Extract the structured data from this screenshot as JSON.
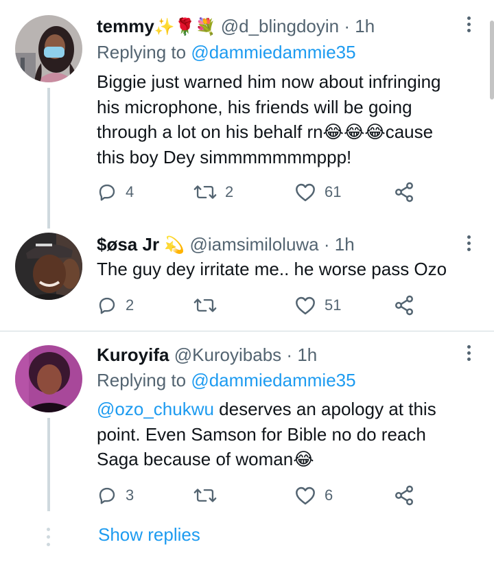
{
  "colors": {
    "accent": "#1d9bf0",
    "secondary": "#536471",
    "text": "#0f1419",
    "line": "#cfd9de"
  },
  "tweets": [
    {
      "name": "temmy",
      "name_emoji": "✨🌹💐",
      "handle": "@d_blingdoyin",
      "dot": "·",
      "time": "1h",
      "replying_prefix": "Replying to",
      "replying_to": "@dammiedammie35",
      "text_lines": [
        "Biggie just warned him now about infringing",
        "his microphone, his friends will be going",
        "through a lot on his behalf rn😂😂😂cause",
        "this boy Dey simmmmmmmppp!"
      ],
      "replies": "4",
      "retweets": "2",
      "likes": "61",
      "icons": {
        "reply": "reply-icon",
        "retweet": "retweet-icon",
        "like": "heart-icon",
        "share": "share-icon",
        "more": "more-icon"
      }
    },
    {
      "name": "$øsa Jr",
      "name_emoji": "💫",
      "handle": "@iamsimiloluwa",
      "dot": "·",
      "time": "1h",
      "text_lines": [
        "The guy dey irritate me.. he worse pass Ozo"
      ],
      "replies": "2",
      "retweets": "",
      "likes": "51"
    },
    {
      "name": "Kuroyifa",
      "handle": "@Kuroyibabs",
      "dot": "·",
      "time": "1h",
      "replying_prefix": "Replying to",
      "replying_to": "@dammiedammie35",
      "mention": "@ozo_chukwu",
      "text_line1_rest": " deserves an apology at this",
      "text_lines_rest": [
        "point. Even Samson for Bible no do reach",
        "Saga because of woman😂"
      ],
      "replies": "3",
      "retweets": "",
      "likes": "6"
    }
  ],
  "show_replies": "Show replies"
}
